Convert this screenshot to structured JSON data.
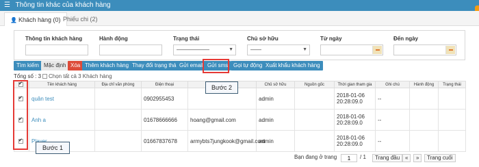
{
  "header": {
    "title": "Thông tin khác của khách hàng",
    "menu_icon": "☰"
  },
  "tabs": [
    {
      "label": "Khách hàng (0)",
      "active": true
    },
    {
      "label": "Phiếu chi (2)",
      "active": false
    }
  ],
  "filters": {
    "customer_info": {
      "label": "Thông tin khách hàng",
      "value": ""
    },
    "action": {
      "label": "Hành động",
      "value": ""
    },
    "status": {
      "label": "Trạng thái",
      "selected": "——————"
    },
    "owner": {
      "label": "Chủ sở hữu",
      "selected": "——"
    },
    "from_date": {
      "label": "Từ ngày",
      "value": ""
    },
    "to_date": {
      "label": "Đến ngày",
      "value": ""
    }
  },
  "buttons": {
    "search": "Tìm kiếm",
    "default": "Mặc định",
    "delete": "Xóa",
    "add_customer": "Thêm khách hàng",
    "change_status": "Thay đổi trạng thái",
    "send_email": "Gửi email",
    "send_sms": "Gửi sms",
    "auto_call": "Gọi tự động",
    "export": "Xuất khẩu khách hàng"
  },
  "summary": {
    "total": "Tổng số : 3",
    "select_all": "Chọn tất cả 3 Khách hàng"
  },
  "table": {
    "columns": [
      "Tên khách hàng",
      "Địa chỉ văn phòng",
      "Điện thoại",
      "",
      "Chủ sở hữu",
      "Nguồn gốc",
      "Thời gian tham gia",
      "Ghi chú",
      "Hành động",
      "Trạng thái"
    ],
    "rows": [
      {
        "name": "quân test",
        "office": "",
        "phone": "0902955453",
        "email": "",
        "owner": "admin",
        "source": "",
        "joined": "2018-01-06 20:28:09.0",
        "note": "--",
        "action": "",
        "status": ""
      },
      {
        "name": "Anh a",
        "office": "",
        "phone": "01678666666",
        "email": "hoang@gmail.com",
        "owner": "admin",
        "source": "",
        "joined": "2018-01-06 20:28:09.0",
        "note": "--",
        "action": "",
        "status": ""
      },
      {
        "name": "Player",
        "office": "",
        "phone": "01667837678",
        "email": "armybts7jungkook@gmail.com",
        "owner": "admin",
        "source": "",
        "joined": "2018-01-06 20:28:09.0",
        "note": "--",
        "action": "",
        "status": ""
      }
    ]
  },
  "annotations": {
    "step1": "Bước 1",
    "step2": "Bước 2"
  },
  "pager": {
    "label": "Bạn đang ở trang",
    "current": "1",
    "total": "/ 1",
    "first": "Trang đầu",
    "prev": "«",
    "next": "»",
    "last": "Trang cuối"
  },
  "colors": {
    "primary": "#3c8dbc",
    "danger": "#dd4b39",
    "highlight": "#e53935"
  }
}
